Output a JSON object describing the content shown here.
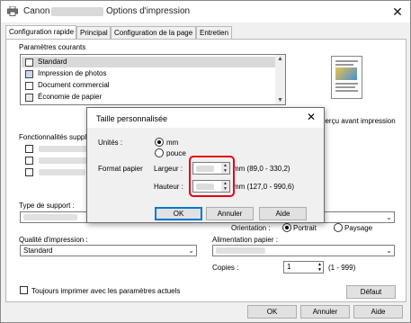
{
  "window": {
    "app_name": "Canon",
    "title": "Options d'impression",
    "close_glyph": "✕"
  },
  "tabs": [
    {
      "label": "Configuration rapide",
      "active": true
    },
    {
      "label": "Principal",
      "active": false
    },
    {
      "label": "Configuration de la page",
      "active": false
    },
    {
      "label": "Entretien",
      "active": false
    }
  ],
  "quick_setup": {
    "current_settings_label": "Paramètres courants",
    "settings_list": [
      {
        "label": "Standard",
        "icon": "document-icon"
      },
      {
        "label": "Impression de photos",
        "icon": "photo-icon"
      },
      {
        "label": "Document commercial",
        "icon": "business-document-icon"
      },
      {
        "label": "Économie de papier",
        "icon": "paper-saving-icon"
      }
    ],
    "scroll_up": "▲",
    "scroll_down": "▼",
    "preview_label": "perçu avant impression",
    "additional_features_label": "Fonctionnalités supplé",
    "media_type_label": "Type de support :",
    "print_quality_label": "Qualité d'impression :",
    "print_quality_value": "Standard",
    "orientation_label": "Orientation :",
    "orientation_options": [
      "Portrait",
      "Paysage"
    ],
    "orientation_selected": "Portrait",
    "paper_source_label": "Alimentation papier :",
    "copies_label": "Copies :",
    "copies_value": "1",
    "copies_range": "(1 - 999)",
    "always_print_label": "Toujours imprimer avec les paramètres actuels",
    "defaults_button": "Défaut"
  },
  "footer": {
    "ok": "OK",
    "cancel": "Annuler",
    "help": "Aide"
  },
  "custom_size_dialog": {
    "title": "Taille personnalisée",
    "close_glyph": "✕",
    "units_label": "Unités :",
    "unit_options": [
      "mm",
      "pouce"
    ],
    "unit_selected": "mm",
    "paper_format_label": "Format papier",
    "width_label": "Largeur :",
    "width_range": "mm (89,0 - 330,2)",
    "height_label": "Hauteur :",
    "height_range": "mm (127,0 - 990,6)",
    "ok": "OK",
    "cancel": "Annuler",
    "help": "Aide"
  },
  "colors": {
    "accent_blue": "#0078d7",
    "highlight_red": "#e60012"
  }
}
